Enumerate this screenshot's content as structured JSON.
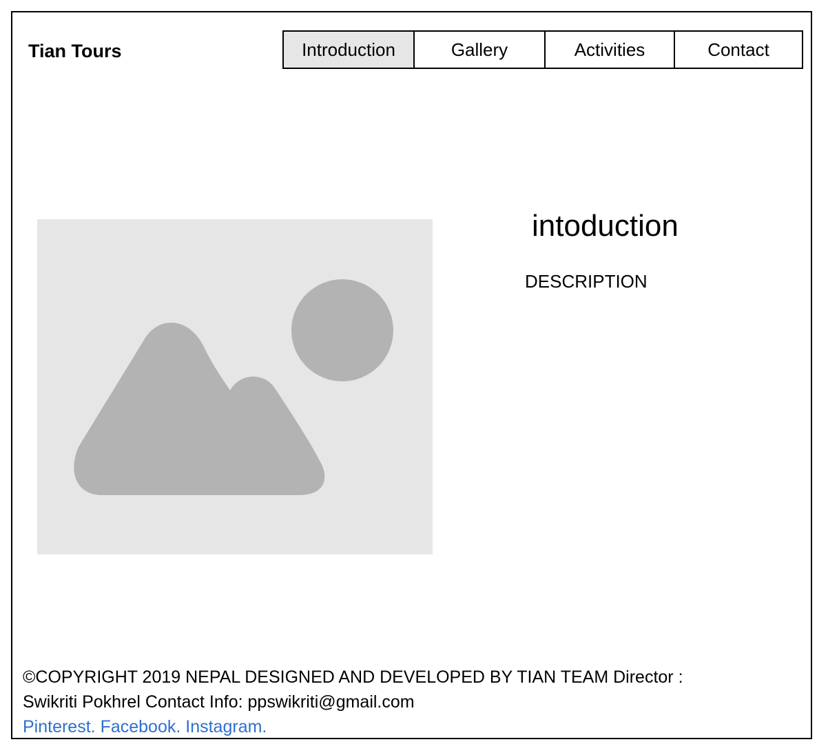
{
  "header": {
    "brand": "Tian Tours",
    "nav": [
      {
        "label": "Introduction",
        "active": true
      },
      {
        "label": "Gallery",
        "active": false
      },
      {
        "label": "Activities",
        "active": false
      },
      {
        "label": "Contact",
        "active": false
      }
    ]
  },
  "main": {
    "image_icon": "image-placeholder-icon",
    "title": "intoduction",
    "description": "DESCRIPTION"
  },
  "footer": {
    "line1": "©COPYRIGHT 2019 NEPAL DESIGNED AND DEVELOPED BY TIAN TEAM Director :",
    "line2": "Swikriti Pokhrel Contact Info: ppswikriti@gmail.com",
    "links": [
      "Pinterest.",
      "Facebook.",
      "Instagram."
    ],
    "link_color": "#2f6fd0"
  },
  "colors": {
    "active_nav_bg": "#e6e6e6",
    "placeholder_bg": "#e6e6e6",
    "placeholder_shape": "#b3b3b3"
  }
}
